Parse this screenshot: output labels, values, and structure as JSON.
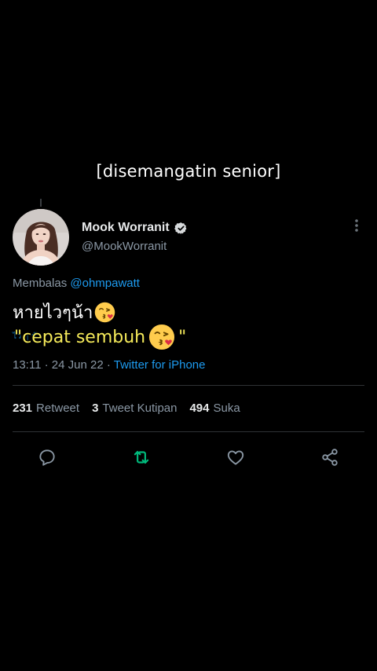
{
  "caption": "[disemangatin senior]",
  "tweet": {
    "display_name": "Mook Worranit",
    "handle": "@MookWorranit",
    "reply_prefix": "Membalas",
    "reply_to": "@ohmpawatt",
    "text": "หายไวๆน้า",
    "faint_text": "ไว ๆ น้า",
    "subtitle_text": "\"cepat sembuh",
    "subtitle_close": "\"",
    "time": "13:11",
    "date": "24 Jun 22",
    "source": "Twitter for iPhone"
  },
  "stats": {
    "retweets_count": "231",
    "retweets_label": "Retweet",
    "quotes_count": "3",
    "quotes_label": "Tweet Kutipan",
    "likes_count": "494",
    "likes_label": "Suka"
  },
  "icons": {
    "verified": "verified-badge-icon",
    "more": "more-vertical-icon",
    "reply": "reply-icon",
    "retweet": "retweet-icon",
    "like": "heart-icon",
    "share": "share-icon",
    "emoji": "face-blowing-kiss-emoji"
  },
  "colors": {
    "background": "#000000",
    "link": "#1d9bf0",
    "secondary_text": "#8b98a5",
    "retweet_active": "#00ba7c",
    "subtitle": "#f5ea5a"
  }
}
